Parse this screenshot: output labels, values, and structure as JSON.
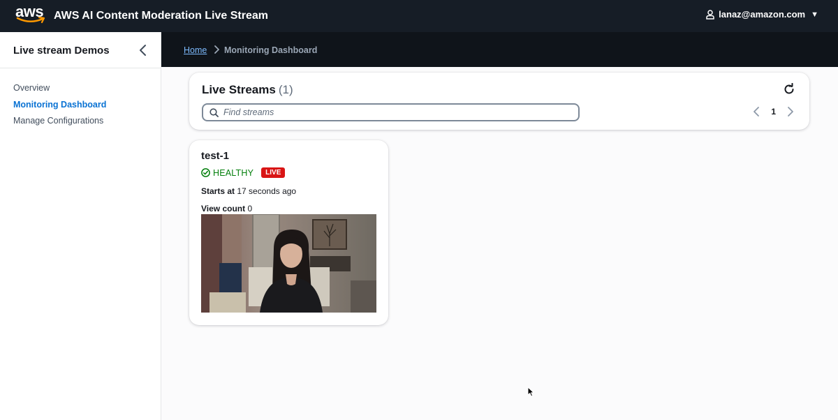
{
  "topbar": {
    "logo_text": "aws",
    "app_title": "AWS AI Content Moderation Live Stream",
    "user_email": "lanaz@amazon.com",
    "user_icon": "user-icon",
    "caret_icon": "caret-down-icon"
  },
  "sidebar": {
    "title": "Live stream Demos",
    "items": [
      {
        "label": "Overview",
        "active": false
      },
      {
        "label": "Monitoring Dashboard",
        "active": true
      },
      {
        "label": "Manage Configurations",
        "active": false
      }
    ]
  },
  "breadcrumb": {
    "home": "Home",
    "current": "Monitoring Dashboard"
  },
  "streams_panel": {
    "title": "Live Streams",
    "count": "(1)",
    "search_placeholder": "Find streams",
    "search_value": "",
    "page": "1"
  },
  "stream_card": {
    "name": "test-1",
    "health": "HEALTHY",
    "badge": "LIVE",
    "starts_label": "Starts at",
    "starts_value": "17 seconds ago",
    "views_label": "View count",
    "views_value": "0"
  },
  "colors": {
    "topbar_bg": "#161d26",
    "breadcrumb_bg": "#0f141a",
    "link": "#7dbbff",
    "active_nav": "#0972d3",
    "healthy": "#037f0c",
    "live_badge": "#d91515"
  }
}
